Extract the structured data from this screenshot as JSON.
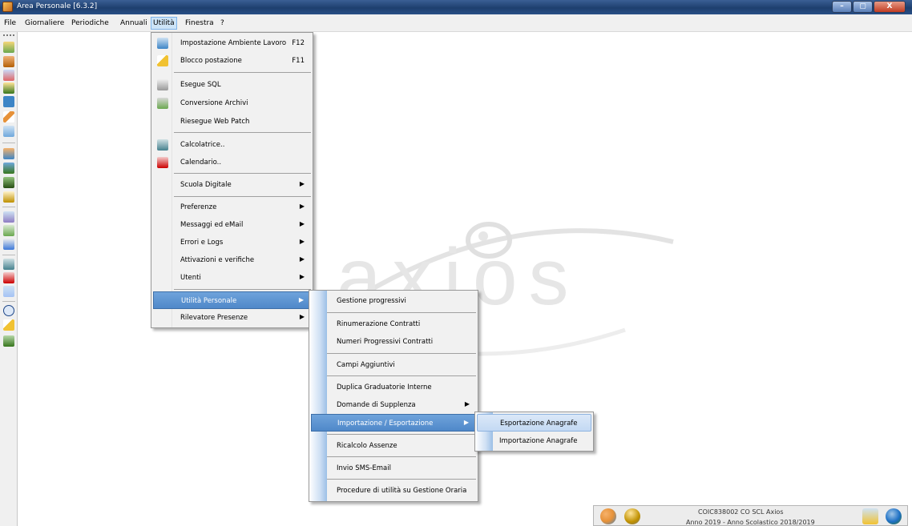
{
  "window": {
    "title": "Area Personale [6.3.2]",
    "buttons": [
      "–",
      "▢",
      "X"
    ]
  },
  "menubar": [
    "File",
    "Giornaliere",
    "Periodiche",
    "Annuali",
    "Utilità",
    "Finestra",
    "?"
  ],
  "utilita_menu": [
    {
      "label": "Impostazione Ambiente Lavoro",
      "shortcut": "F12",
      "icon": "workspace-icon"
    },
    {
      "label": "Blocco postazione",
      "shortcut": "F11",
      "icon": "lock-station-icon"
    },
    {
      "label": "Esegue SQL",
      "icon": "sql-icon"
    },
    {
      "label": "Conversione Archivi",
      "icon": "convert-archive-icon"
    },
    {
      "label": "Riesegue Web Patch"
    },
    {
      "label": "Calcolatrice..",
      "icon": "calculator-icon"
    },
    {
      "label": "Calendario..",
      "icon": "calendar-icon"
    },
    {
      "label": "Scuola Digitale",
      "submenu": true
    },
    {
      "label": "Preferenze",
      "submenu": true
    },
    {
      "label": "Messaggi ed eMail",
      "submenu": true
    },
    {
      "label": "Errori e Logs",
      "submenu": true
    },
    {
      "label": "Attivazioni e verifiche",
      "submenu": true
    },
    {
      "label": "Utenti",
      "submenu": true
    },
    {
      "label": "Utilità Personale",
      "submenu": true,
      "selected": true
    },
    {
      "label": "Rilevatore Presenze",
      "submenu": true
    }
  ],
  "utilita_personale_menu": [
    {
      "label": "Gestione progressivi"
    },
    {
      "label": "Rinumerazione Contratti"
    },
    {
      "label": "Numeri Progressivi Contratti"
    },
    {
      "label": "Campi Aggiuntivi"
    },
    {
      "label": "Duplica Graduatorie Interne"
    },
    {
      "label": "Domande di Supplenza",
      "submenu": true
    },
    {
      "label": "Importazione / Esportazione",
      "submenu": true,
      "selected": true
    },
    {
      "label": "Ricalcolo Assenze"
    },
    {
      "label": "Invio SMS-Email"
    },
    {
      "label": "Procedure di utilità su Gestione Oraria"
    }
  ],
  "import_export_menu": [
    {
      "label": "Esportazione Anagrafe",
      "highlighted": true
    },
    {
      "label": "Importazione Anagrafe"
    }
  ],
  "watermark": {
    "text": "axios"
  },
  "statusbar": {
    "line1": "COIC838002 CO SCL Axios",
    "line2": "Anno 2019 - Anno Scolastico 2018/2019"
  },
  "colors": {
    "titlebar": "#1e3f6e",
    "selection": "#4f88c9",
    "highlight": "#c3d9f3"
  }
}
